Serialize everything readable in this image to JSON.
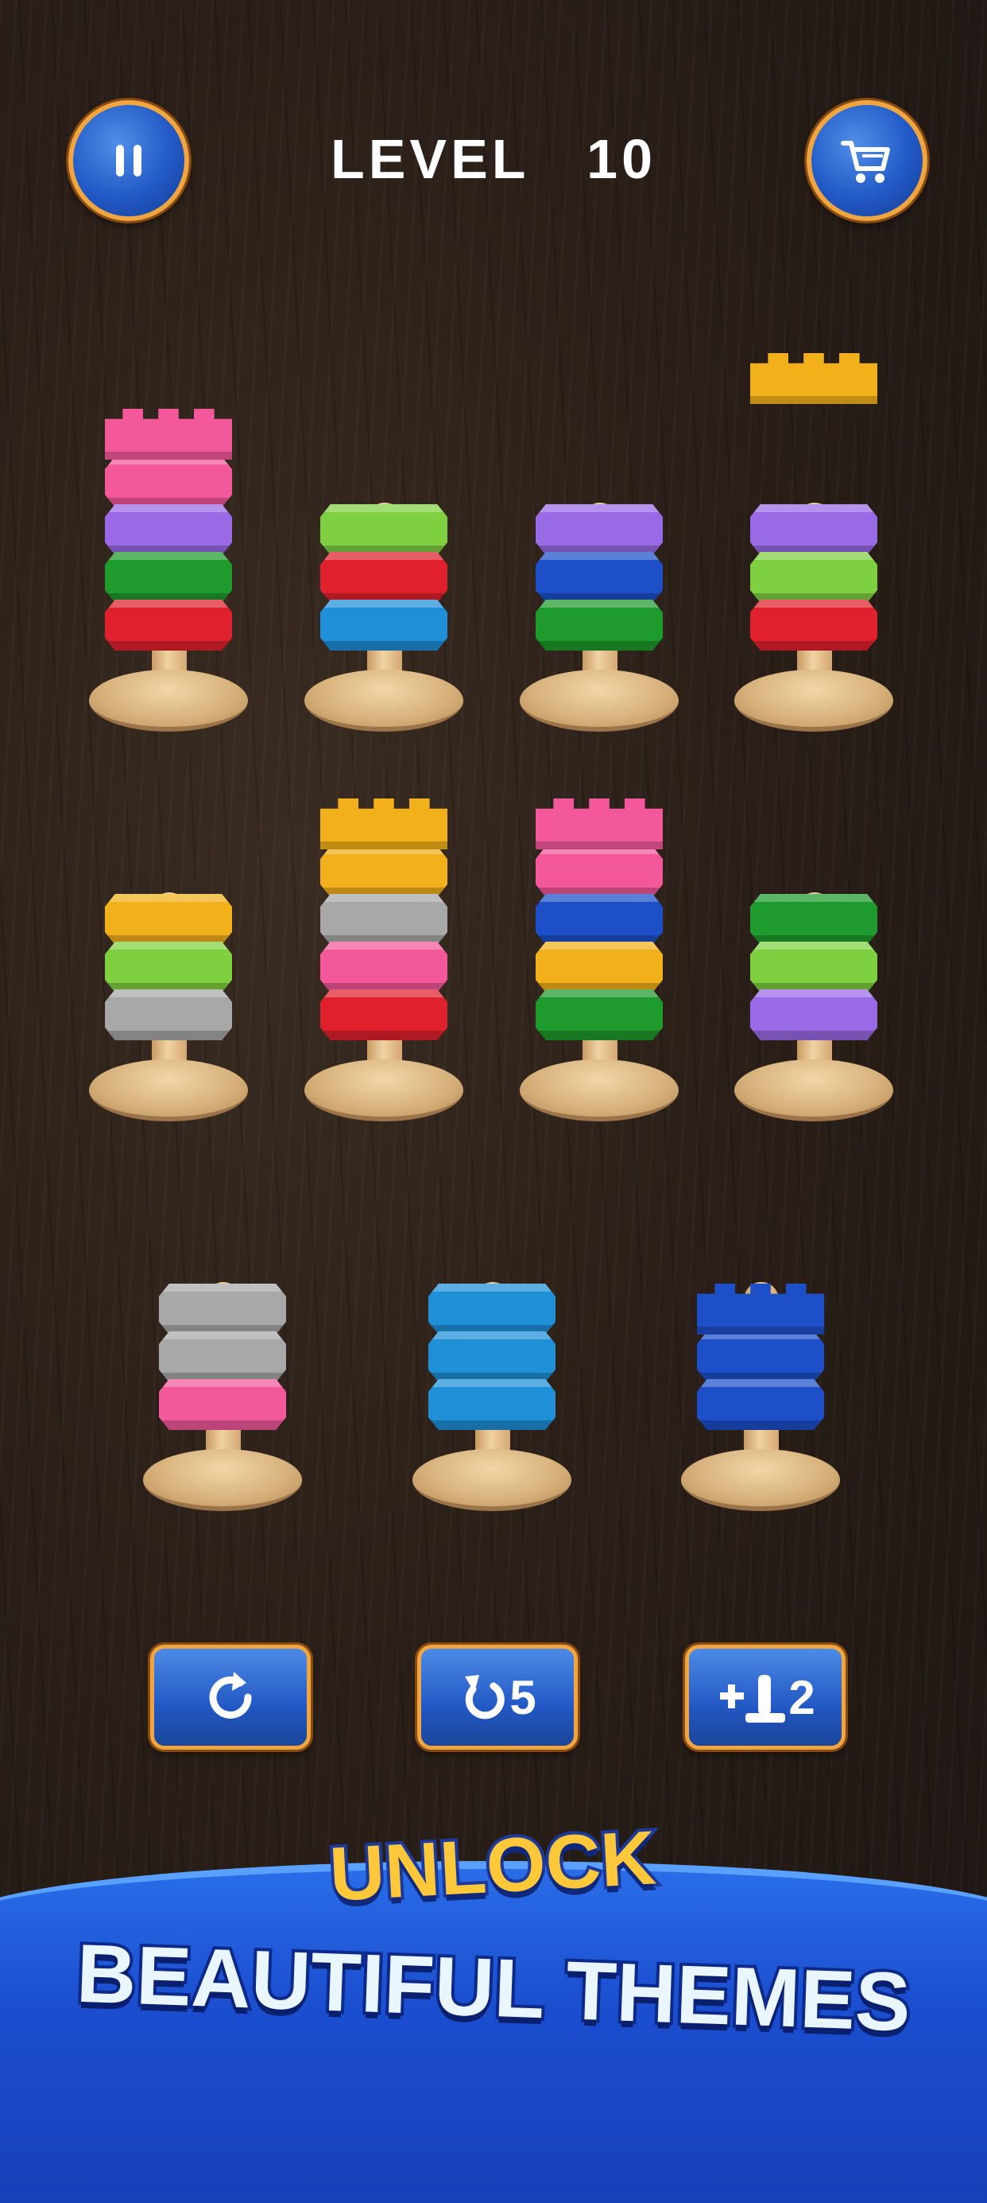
{
  "header": {
    "level_label": "LEVEL",
    "level_number": "10",
    "pause_icon": "pause-icon",
    "shop_icon": "cart-icon"
  },
  "colors": {
    "pink": "#f2589a",
    "purple": "#9a6ae6",
    "green": "#1f9a2c",
    "lime": "#7fd040",
    "red": "#e0202c",
    "blue": "#1f8fd8",
    "yellow": "#f2b01a",
    "gray": "#a8a8a8",
    "navy": "#1c4fc8",
    "button_blue": "#2259c6",
    "button_border": "#f0a640"
  },
  "towers": [
    {
      "rings_bottom_to_top": [
        "red",
        "green",
        "purple",
        "pink"
      ],
      "top_piece": "crown-pink"
    },
    {
      "rings_bottom_to_top": [
        "blue",
        "red",
        "lime"
      ],
      "top_piece": "peg"
    },
    {
      "rings_bottom_to_top": [
        "green",
        "navy",
        "purple"
      ],
      "top_piece": "peg"
    },
    {
      "rings_bottom_to_top": [
        "red",
        "lime",
        "purple"
      ],
      "top_piece": "crown-yellow-lifted"
    },
    {
      "rings_bottom_to_top": [
        "gray",
        "lime",
        "yellow"
      ],
      "top_piece": "peg"
    },
    {
      "rings_bottom_to_top": [
        "red",
        "pink",
        "gray",
        "yellow"
      ],
      "top_piece": "crown-yellow"
    },
    {
      "rings_bottom_to_top": [
        "green",
        "yellow",
        "navy",
        "pink"
      ],
      "top_piece": "crown-pink"
    },
    {
      "rings_bottom_to_top": [
        "purple",
        "lime",
        "green"
      ],
      "top_piece": "peg"
    },
    {
      "rings_bottom_to_top": [
        "pink",
        "gray",
        "gray"
      ],
      "top_piece": "peg"
    },
    {
      "rings_bottom_to_top": [
        "blue",
        "blue",
        "blue"
      ],
      "top_piece": "peg"
    },
    {
      "rings_bottom_to_top": [
        "navy",
        "navy"
      ],
      "top_piece": "crown-navy"
    }
  ],
  "actions": {
    "restart_icon": "restart-icon",
    "undo_icon": "undo-icon",
    "undo_count": "5",
    "add_peg_icon": "add-peg-icon",
    "add_peg_count": "2"
  },
  "banner": {
    "line1": "UNLOCK",
    "line2": "BEAUTIFUL THEMES"
  }
}
